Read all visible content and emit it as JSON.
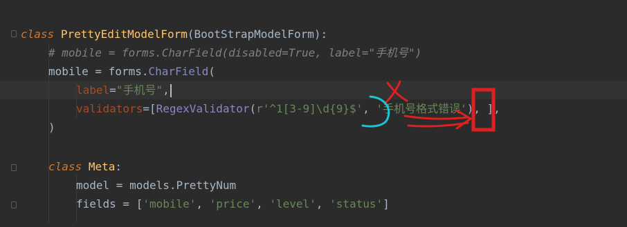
{
  "code": {
    "line1": {
      "kw": "class",
      "name": "PrettyEditModelForm",
      "rest": "(BootStrapModelForm):"
    },
    "line2": {
      "comment": "# mobile = forms.CharField(disabled=True, label=\"手机号\")"
    },
    "line3": {
      "pre": "mobile = forms.",
      "call": "CharField",
      "post": "("
    },
    "line4": {
      "param": "label",
      "eq": "=",
      "str": "\"手机号\"",
      "post": ","
    },
    "line5": {
      "param": "validators",
      "eq": "=[",
      "call": "RegexValidator",
      "open": "(",
      "regex": "r'^1[3-9]\\d{9}$'",
      "sep": ", ",
      "msg": "'手机号格式错误'",
      "post": "), ],"
    },
    "line6": {
      "text": ")"
    },
    "line7": {
      "kw": "class",
      "name": "Meta",
      "rest": ":"
    },
    "line8": {
      "text": "model = models.PrettyNum"
    },
    "line9": {
      "pre": "fields = [",
      "f1": "'mobile'",
      "s1": ", ",
      "f2": "'price'",
      "s2": ", ",
      "f3": "'level'",
      "s3": ", ",
      "f4": "'status'",
      "post": "]"
    }
  },
  "annotations": {
    "highlight_color": "#e02020",
    "circle_color": "#18c6d6"
  }
}
